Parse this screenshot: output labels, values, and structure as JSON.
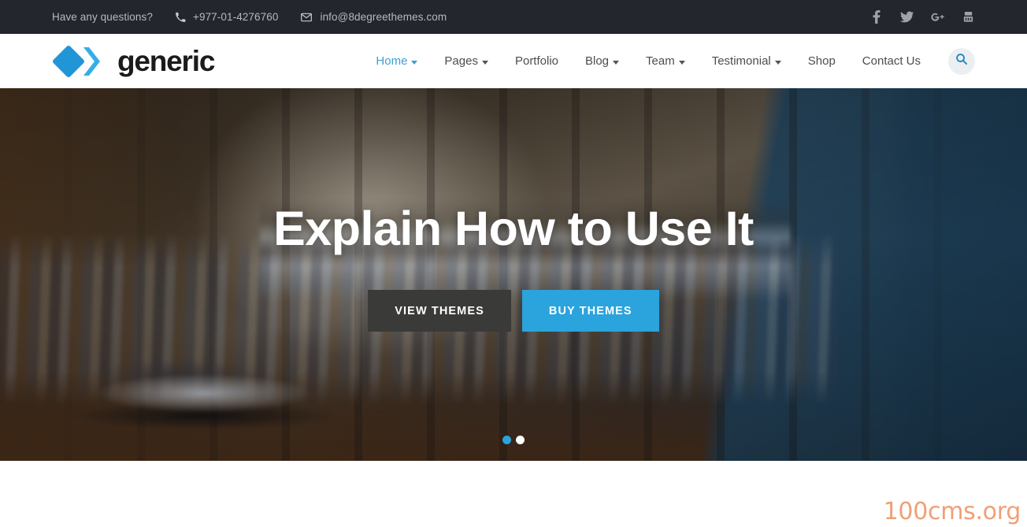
{
  "topbar": {
    "question": "Have any questions?",
    "phone": "+977-01-4276760",
    "email": "info@8degreethemes.com",
    "phone_icon": "phone-icon",
    "email_icon": "envelope-icon",
    "social": [
      {
        "name": "facebook-icon",
        "label": "Facebook"
      },
      {
        "name": "twitter-icon",
        "label": "Twitter"
      },
      {
        "name": "google-plus-icon",
        "label": "Google Plus"
      },
      {
        "name": "youtube-icon",
        "label": "YouTube"
      }
    ],
    "bg_color": "#24262e",
    "text_color": "#b6b9c1"
  },
  "header": {
    "logo_text": "generic",
    "logo_icon": "diamond-chevron-logo",
    "logo_color": "#2ba3dc",
    "nav": [
      {
        "label": "Home",
        "has_dropdown": true,
        "active": true
      },
      {
        "label": "Pages",
        "has_dropdown": true,
        "active": false
      },
      {
        "label": "Portfolio",
        "has_dropdown": false,
        "active": false
      },
      {
        "label": "Blog",
        "has_dropdown": true,
        "active": false
      },
      {
        "label": "Team",
        "has_dropdown": true,
        "active": false
      },
      {
        "label": "Testimonial",
        "has_dropdown": true,
        "active": false
      },
      {
        "label": "Shop",
        "has_dropdown": false,
        "active": false
      },
      {
        "label": "Contact Us",
        "has_dropdown": false,
        "active": false
      }
    ],
    "search_icon": "search-icon",
    "active_color": "#3d9fd4"
  },
  "hero": {
    "title": "Explain How to Use It",
    "primary_button": "VIEW THEMES",
    "secondary_button": "BUY THEMES",
    "primary_color": "#3a3a38",
    "secondary_color": "#2ba3dc",
    "slides": [
      {
        "index": 1,
        "active": true
      },
      {
        "index": 2,
        "active": false
      }
    ],
    "image_description": "clothing store interior with shelves of folded shirts and hanging garments"
  },
  "watermark": {
    "text": "100cms.org",
    "color": "#efa077"
  }
}
